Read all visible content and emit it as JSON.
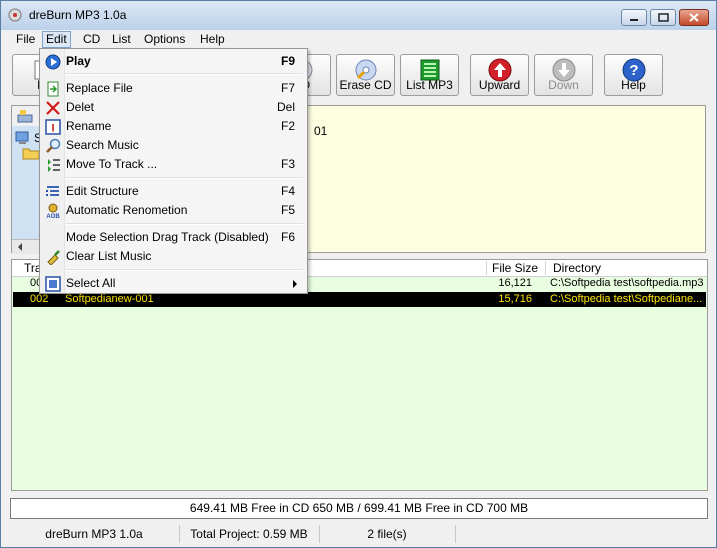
{
  "window": {
    "title": "dreBurn MP3 1.0a"
  },
  "menubar": {
    "items": [
      "File",
      "Edit",
      "CD",
      "List",
      "Options",
      "Help"
    ]
  },
  "toolbar": {
    "buttons": [
      {
        "label": "N",
        "icon": "new-icon",
        "disabled": false
      },
      {
        "label": "CD",
        "icon": "burn-cd-icon",
        "disabled": false
      },
      {
        "label": "Erase CD",
        "icon": "erase-cd-icon",
        "disabled": false
      },
      {
        "label": "List MP3",
        "icon": "list-mp3-icon",
        "disabled": false
      },
      {
        "label": "Upward",
        "icon": "arrow-up-icon",
        "disabled": false
      },
      {
        "label": "Down",
        "icon": "arrow-down-icon",
        "disabled": true
      },
      {
        "label": "Help",
        "icon": "help-icon",
        "disabled": false
      }
    ]
  },
  "tree": {
    "node_label": "S",
    "right_text": "01"
  },
  "edit_menu": {
    "items": [
      {
        "label": "Play",
        "shortcut": "F9",
        "icon": "play-icon"
      },
      {
        "label": "Replace File",
        "shortcut": "F7",
        "icon": "replace-file-icon"
      },
      {
        "label": "Delet",
        "shortcut": "Del",
        "icon": "delete-icon"
      },
      {
        "label": "Rename",
        "shortcut": "F2",
        "icon": "rename-icon"
      },
      {
        "label": "Search Music",
        "shortcut": "",
        "icon": "search-icon"
      },
      {
        "label": "Move To Track ...",
        "shortcut": "F3",
        "icon": "move-track-icon"
      },
      {
        "label": "Edit Structure",
        "shortcut": "F4",
        "icon": "edit-structure-icon"
      },
      {
        "label": "Automatic Renometion",
        "shortcut": "F5",
        "icon": "auto-rename-icon"
      },
      {
        "label": "Mode Selection Drag Track (Disabled)",
        "shortcut": "F6",
        "icon": ""
      },
      {
        "label": "Clear List Music",
        "shortcut": "",
        "icon": "clear-list-icon"
      },
      {
        "label": "Select All",
        "shortcut": "",
        "icon": "select-all-icon"
      }
    ]
  },
  "file_list": {
    "columns": {
      "track": "Tra",
      "size": "File Size",
      "directory": "Directory"
    },
    "rows": [
      {
        "track": "00",
        "name": "",
        "size": "16,121",
        "directory": "C:\\Softpedia test\\softpedia.mp3"
      },
      {
        "track": "002",
        "name": "Softpedianew-001",
        "size": "15,716",
        "directory": "C:\\Softpedia test\\Softpediane..."
      }
    ]
  },
  "free_space": "649.41 MB Free in CD 650 MB / 699.41 MB Free in CD 700 MB",
  "statusbar": {
    "app": "dreBurn MP3 1.0a",
    "project": "Total Project: 0.59 MB",
    "files": "2 file(s)"
  },
  "colors": {
    "tree_bg": "#fdfde0",
    "list_bg": "#e9fde0",
    "selected_row_bg": "#000000",
    "selected_row_fg": "#ffe600"
  }
}
